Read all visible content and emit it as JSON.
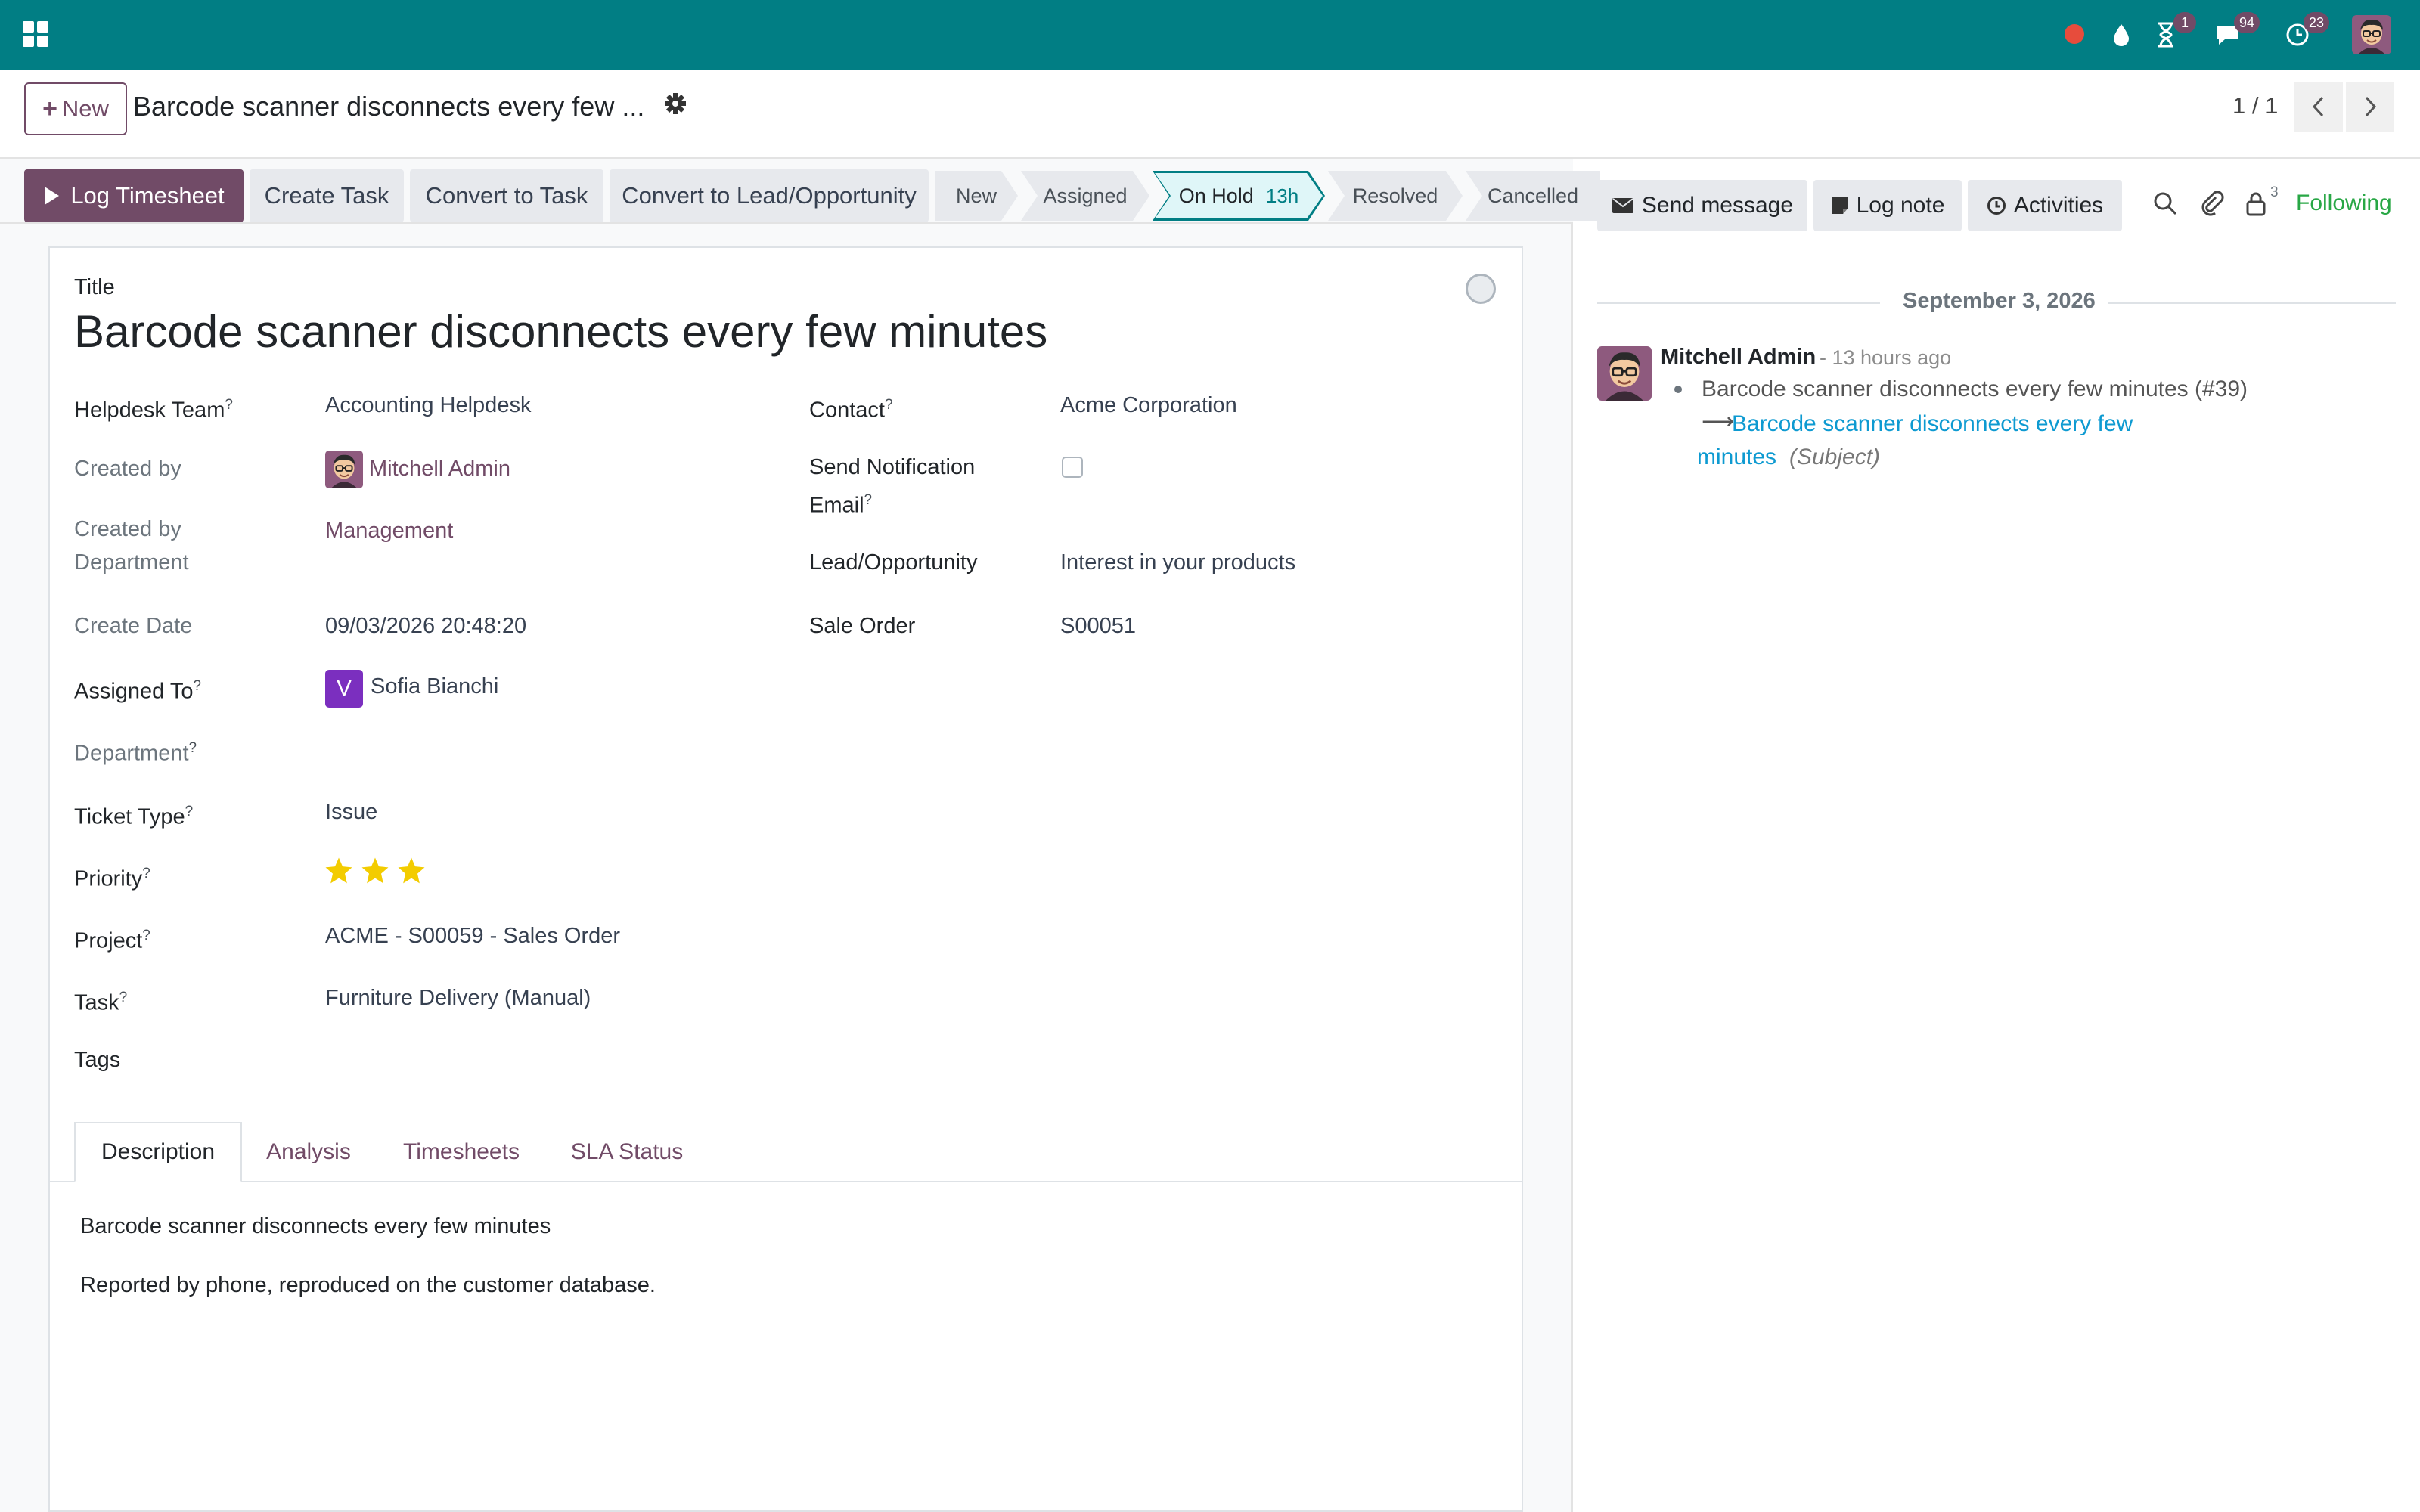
{
  "colors": {
    "topbar": "#017e84",
    "primary": "#714b67",
    "link": "#0d9ad1",
    "following": "#28a745",
    "star": "#f3cc00"
  },
  "topbar": {
    "apps_icon": "grid-icon",
    "icons": [
      "record-icon",
      "drop-icon",
      "hourglass-icon",
      "chat-icon",
      "clock-icon"
    ],
    "badges": {
      "activities": "1",
      "messages": "94",
      "clock": "23"
    }
  },
  "control": {
    "new_label": "New",
    "breadcrumb_title": "Barcode scanner disconnects every few ...",
    "pager": "1 / 1"
  },
  "actions": {
    "log_timesheet": "Log Timesheet",
    "create_task": "Create Task",
    "convert_to_task": "Convert to Task",
    "convert_to_lead": "Convert to Lead/Opportunity"
  },
  "stages": {
    "new": "New",
    "assigned": "Assigned",
    "on_hold": "On Hold",
    "on_hold_duration": "13h",
    "resolved": "Resolved",
    "cancelled": "Cancelled"
  },
  "form": {
    "title_label": "Title",
    "title": "Barcode scanner disconnects every few minutes",
    "tooltip_mark": "?",
    "fields": {
      "helpdesk_team": {
        "label": "Helpdesk Team",
        "value": "Accounting Helpdesk"
      },
      "created_by": {
        "label": "Created by",
        "value": "Mitchell Admin"
      },
      "created_by_dept_1": {
        "label": "Created by"
      },
      "created_by_dept_2": {
        "label": "Department",
        "value": "Management"
      },
      "create_date": {
        "label": "Create Date",
        "value": "09/03/2026 20:48:20"
      },
      "assigned_to": {
        "label": "Assigned To",
        "initial": "V",
        "value": "Sofia Bianchi"
      },
      "department": {
        "label": "Department"
      },
      "ticket_type": {
        "label": "Ticket Type",
        "value": "Issue"
      },
      "priority": {
        "label": "Priority",
        "stars_filled": 3
      },
      "project": {
        "label": "Project",
        "value": "ACME - S00059 - Sales Order"
      },
      "task": {
        "label": "Task",
        "value": "Furniture Delivery (Manual)"
      },
      "tags": {
        "label": "Tags"
      },
      "contact": {
        "label": "Contact",
        "value": "Acme Corporation"
      },
      "send_notification_1": {
        "label": "Send Notification"
      },
      "send_notification_2": {
        "label": "Email",
        "checked": false
      },
      "lead": {
        "label": "Lead/Opportunity",
        "value": "Interest in your products"
      },
      "sale_order": {
        "label": "Sale Order",
        "value": "S00051"
      }
    }
  },
  "tabs": {
    "description": "Description",
    "analysis": "Analysis",
    "timesheets": "Timesheets",
    "sla_status": "SLA Status"
  },
  "description": {
    "line1": "Barcode scanner disconnects every few minutes",
    "line2": "Reported by phone, reproduced on the customer database."
  },
  "chatter": {
    "send_message": "Send message",
    "log_note": "Log note",
    "activities": "Activities",
    "followers_count": "3",
    "following": "Following",
    "date": "September 3, 2026",
    "message": {
      "author": "Mitchell Admin",
      "time": "- 13 hours ago",
      "old_value": "Barcode scanner disconnects every few minutes (#39)",
      "arrow": "⟶",
      "new_value_1": "Barcode scanner disconnects every few",
      "new_value_2": "minutes",
      "field": "(Subject)"
    }
  }
}
